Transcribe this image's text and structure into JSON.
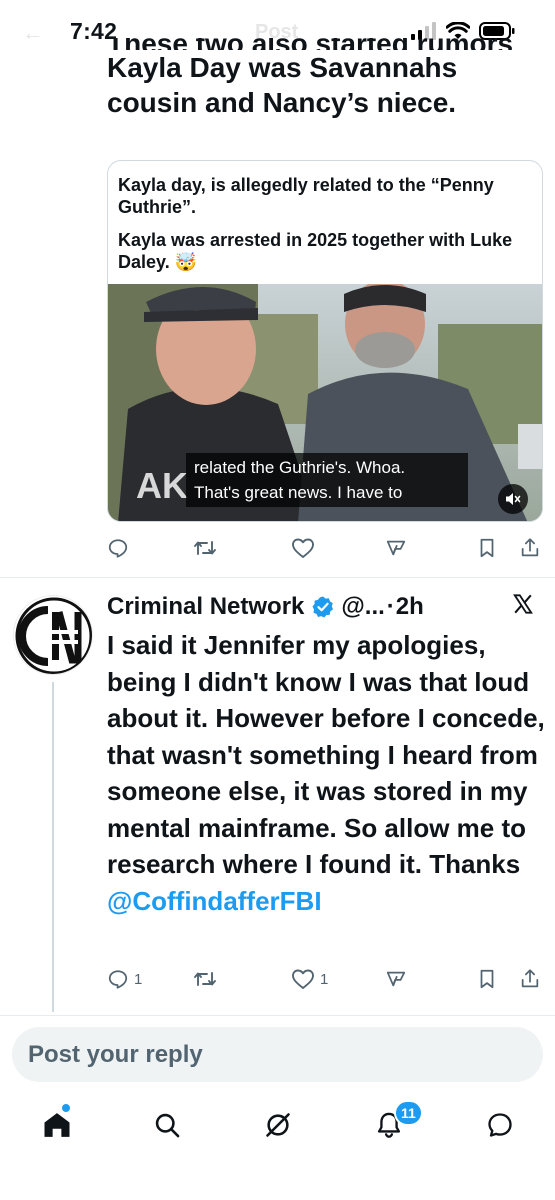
{
  "status_bar": {
    "time": "7:42"
  },
  "header": {
    "ghost_title": "Post"
  },
  "previous_post": {
    "clipped_line": "These two also started rumors",
    "text_line1": "Kayla Day was Savannahs",
    "text_line2": "cousin and Nancy’s niece."
  },
  "quoted_post": {
    "paragraph1": "Kayla day, is allegedly related to the “Penny Guthrie”.",
    "paragraph2": "Kayla was arrested in 2025 together with Luke Daley. 🤯",
    "video_caption_line1": "related the Guthrie's. Whoa.",
    "video_caption_line2": "That's great news. I have to"
  },
  "tweet": {
    "avatar_label": "CN",
    "author": "Criminal Network",
    "handle": "@...",
    "separator": "·",
    "time_ago": "2h",
    "body": "I said it Jennifer my apologies, being I didn't know I was that loud about it. However before I concede, that wasn't something I heard from someone else, it was stored in my mental mainframe. So allow me to research where I found it. Thanks ",
    "mention": "@CoffindafferFBI",
    "reply_count": "1",
    "like_count": "1"
  },
  "reply_box": {
    "placeholder": "Post your reply"
  },
  "tab_bar": {
    "notifications_badge": "11"
  },
  "colors": {
    "accent": "#1d9bf0",
    "text": "#0f1419",
    "muted": "#536471"
  }
}
